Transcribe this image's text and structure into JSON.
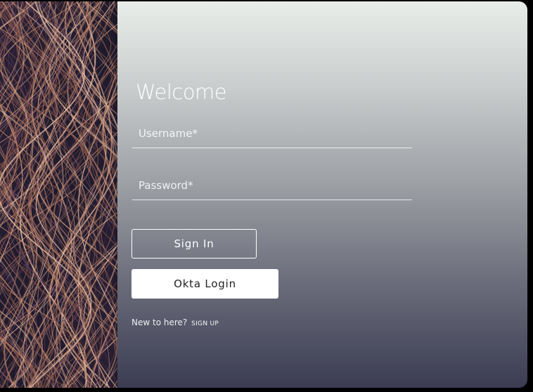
{
  "login": {
    "heading": "Welcome",
    "username_placeholder": "Username*",
    "password_placeholder": "Password*",
    "signin_label": "Sign In",
    "okta_label": "Okta Login",
    "signup_prompt": "New to here?",
    "signup_link": "SIGN UP"
  },
  "colors": {
    "panel_top": "#e9ede9",
    "panel_bottom": "#3b3c52",
    "art_base": "#241c2b",
    "art_strand": "#c48a6e"
  }
}
